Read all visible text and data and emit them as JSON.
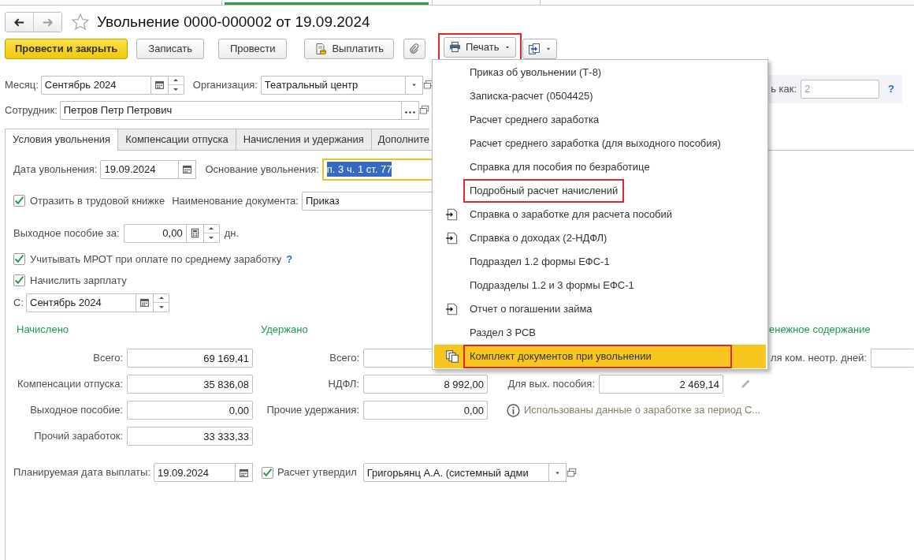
{
  "window": {
    "title": "Увольнение 0000-000002 от 19.09.2024"
  },
  "toolbar": [
    {
      "kind": "primary",
      "label": "Провести и закрыть",
      "highlighted": false
    },
    {
      "kind": "plain",
      "label": "Записать",
      "highlighted": false
    },
    {
      "kind": "plain",
      "label": "Провести",
      "highlighted": false
    },
    {
      "kind": "pay",
      "label": "Выплатить",
      "highlighted": false
    },
    {
      "kind": "attach",
      "highlighted": false
    },
    {
      "kind": "print",
      "label": "Печать",
      "highlighted": true
    },
    {
      "kind": "export",
      "highlighted": false
    }
  ],
  "month": {
    "label": "Месяц:",
    "value": "Сентябрь 2024"
  },
  "organization": {
    "label": "Организация:",
    "value": "Театральный центр"
  },
  "number_panel": {
    "label": "ь как:",
    "value": "2",
    "disabled": true,
    "help": "?"
  },
  "employee": {
    "label": "Сотрудник:",
    "value": "Петров Петр Петрович"
  },
  "tabs": [
    {
      "label": "Условия увольнения",
      "selected": true
    },
    {
      "label": "Компенсации отпуска",
      "selected": false
    },
    {
      "label": "Начисления и удержания",
      "selected": false
    },
    {
      "label": "Дополните",
      "selected": false
    }
  ],
  "dismissal_date": {
    "label": "Дата увольнения:",
    "value": "19.09.2024"
  },
  "reason": {
    "label": "Основание увольнения:",
    "value": "п. 3 ч. 1 ст. 77",
    "text_selected": true
  },
  "work_book": {
    "label": "Отразить в трудовой книжке",
    "checked": true
  },
  "document_name": {
    "label": "Наименование документа:",
    "value": "Приказ"
  },
  "severance": {
    "label": "Выходное пособие за:",
    "value": "0,00",
    "unit": "дн."
  },
  "mrot": {
    "label": "Учитывать МРОТ при оплате по среднему заработку",
    "checked": true,
    "help": "?"
  },
  "accrue_salary": {
    "label": "Начислить зарплату",
    "checked": true
  },
  "from": {
    "label": "С:",
    "value": "Сентябрь 2024"
  },
  "sections": [
    {
      "title": "Начислено"
    },
    {
      "title": "Удержано"
    },
    {
      "title": "енежное содержание"
    }
  ],
  "accrued": [
    {
      "label": "Всего:",
      "value": "69 169,41"
    },
    {
      "label": "Компенсации отпуска:",
      "value": "35 836,08"
    },
    {
      "label": "Выходное пособие:",
      "value": "0,00"
    },
    {
      "label": "Прочий заработок:",
      "value": "33 333,33"
    }
  ],
  "withheld": [
    {
      "label": "Всего:"
    },
    {
      "label": "НДФЛ:",
      "value": "8 992,00"
    },
    {
      "label": "Прочие удержания:",
      "value": "0,00"
    }
  ],
  "unused_days": {
    "label": "ля ком. неотр. дней:"
  },
  "severance_amount": {
    "label": "Для вых. пособия:",
    "value": "2 469,14"
  },
  "info_note": "Использованы данные о заработке за период С...",
  "payment_date": {
    "label": "Планируемая дата выплаты:",
    "value": "19.09.2024"
  },
  "approved": {
    "label": "Расчет утвердил",
    "checked": true,
    "value": "Григорьянц А.А. (системный адми"
  },
  "print_menu": [
    {
      "label": "Приказ об увольнении (Т-8)",
      "kind": "plain",
      "selected": false,
      "highlighted": false
    },
    {
      "label": "Записка-расчет (0504425)",
      "kind": "plain",
      "selected": false,
      "highlighted": false
    },
    {
      "label": "Расчет среднего заработка",
      "kind": "plain",
      "selected": false,
      "highlighted": false
    },
    {
      "label": "Расчет среднего заработка (для выходного пособия)",
      "kind": "plain",
      "selected": false,
      "highlighted": false
    },
    {
      "label": "Справка для пособия по безработице",
      "kind": "plain",
      "selected": false,
      "highlighted": false
    },
    {
      "label": "Подробный расчет начислений",
      "kind": "plain",
      "selected": false,
      "highlighted": true
    },
    {
      "label": "Справка о заработке для расчета пособий",
      "kind": "external",
      "selected": false,
      "highlighted": false
    },
    {
      "label": "Справка о доходах (2-НДФЛ)",
      "kind": "external",
      "selected": false,
      "highlighted": false
    },
    {
      "label": "Подраздел 1.2 формы ЕФС-1",
      "kind": "plain",
      "selected": false,
      "highlighted": false
    },
    {
      "label": "Подразделы 1.2 и 3 формы ЕФС-1",
      "kind": "plain",
      "selected": false,
      "highlighted": false
    },
    {
      "label": "Отчет о погашении займа",
      "kind": "external",
      "selected": false,
      "highlighted": false
    },
    {
      "label": "Раздел 3 РСВ",
      "kind": "plain",
      "selected": false,
      "highlighted": false
    },
    {
      "label": "Комплект документов при увольнении",
      "kind": "set",
      "selected": true,
      "highlighted": true
    }
  ]
}
